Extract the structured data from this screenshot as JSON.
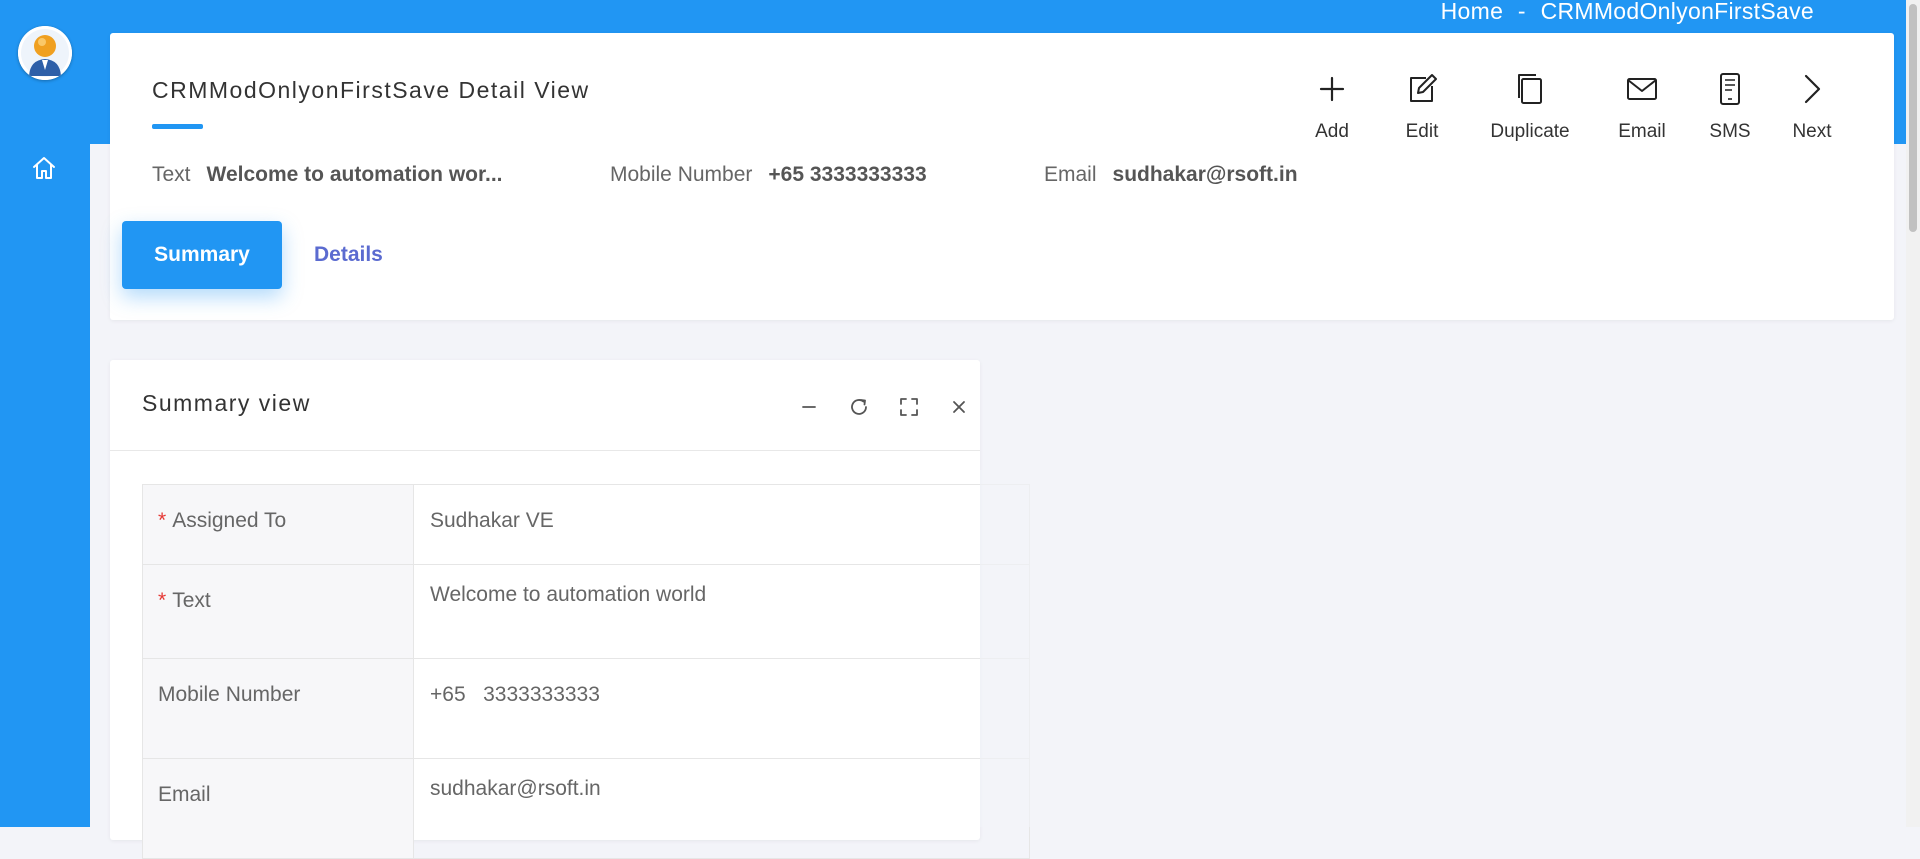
{
  "breadcrumb": {
    "home": "Home",
    "separator": "-",
    "current": "CRMModOnlyonFirstSave"
  },
  "header": {
    "title": "CRMModOnlyonFirstSave Detail View",
    "actions": [
      {
        "label": "Add",
        "icon": "plus-icon"
      },
      {
        "label": "Edit",
        "icon": "edit-icon"
      },
      {
        "label": "Duplicate",
        "icon": "duplicate-icon"
      },
      {
        "label": "Email",
        "icon": "email-icon"
      },
      {
        "label": "SMS",
        "icon": "sms-icon"
      },
      {
        "label": "Next",
        "icon": "chevron-right-icon"
      }
    ],
    "meta": [
      {
        "label": "Text",
        "value": "Welcome to automation wor..."
      },
      {
        "label": "Mobile Number",
        "value": "+65 3333333333"
      },
      {
        "label": "Email",
        "value": "sudhakar@rsoft.in"
      }
    ]
  },
  "tabs": [
    {
      "label": "Summary",
      "active": true
    },
    {
      "label": "Details",
      "active": false
    }
  ],
  "summary": {
    "title": "Summary view",
    "tools": [
      "minimize-icon",
      "refresh-icon",
      "fullscreen-icon",
      "close-icon"
    ],
    "fields": [
      {
        "label": "Assigned To",
        "required": true,
        "value": "Sudhakar VE"
      },
      {
        "label": "Text",
        "required": true,
        "value": "Welcome to automation world"
      },
      {
        "label": "Mobile Number",
        "required": false,
        "value": "+65   3333333333"
      },
      {
        "label": "Email",
        "required": false,
        "value": "sudhakar@rsoft.in"
      }
    ]
  },
  "colors": {
    "primary": "#2196f3",
    "background": "#f3f4f9",
    "required": "#e53935",
    "link": "#5b6bd0"
  }
}
